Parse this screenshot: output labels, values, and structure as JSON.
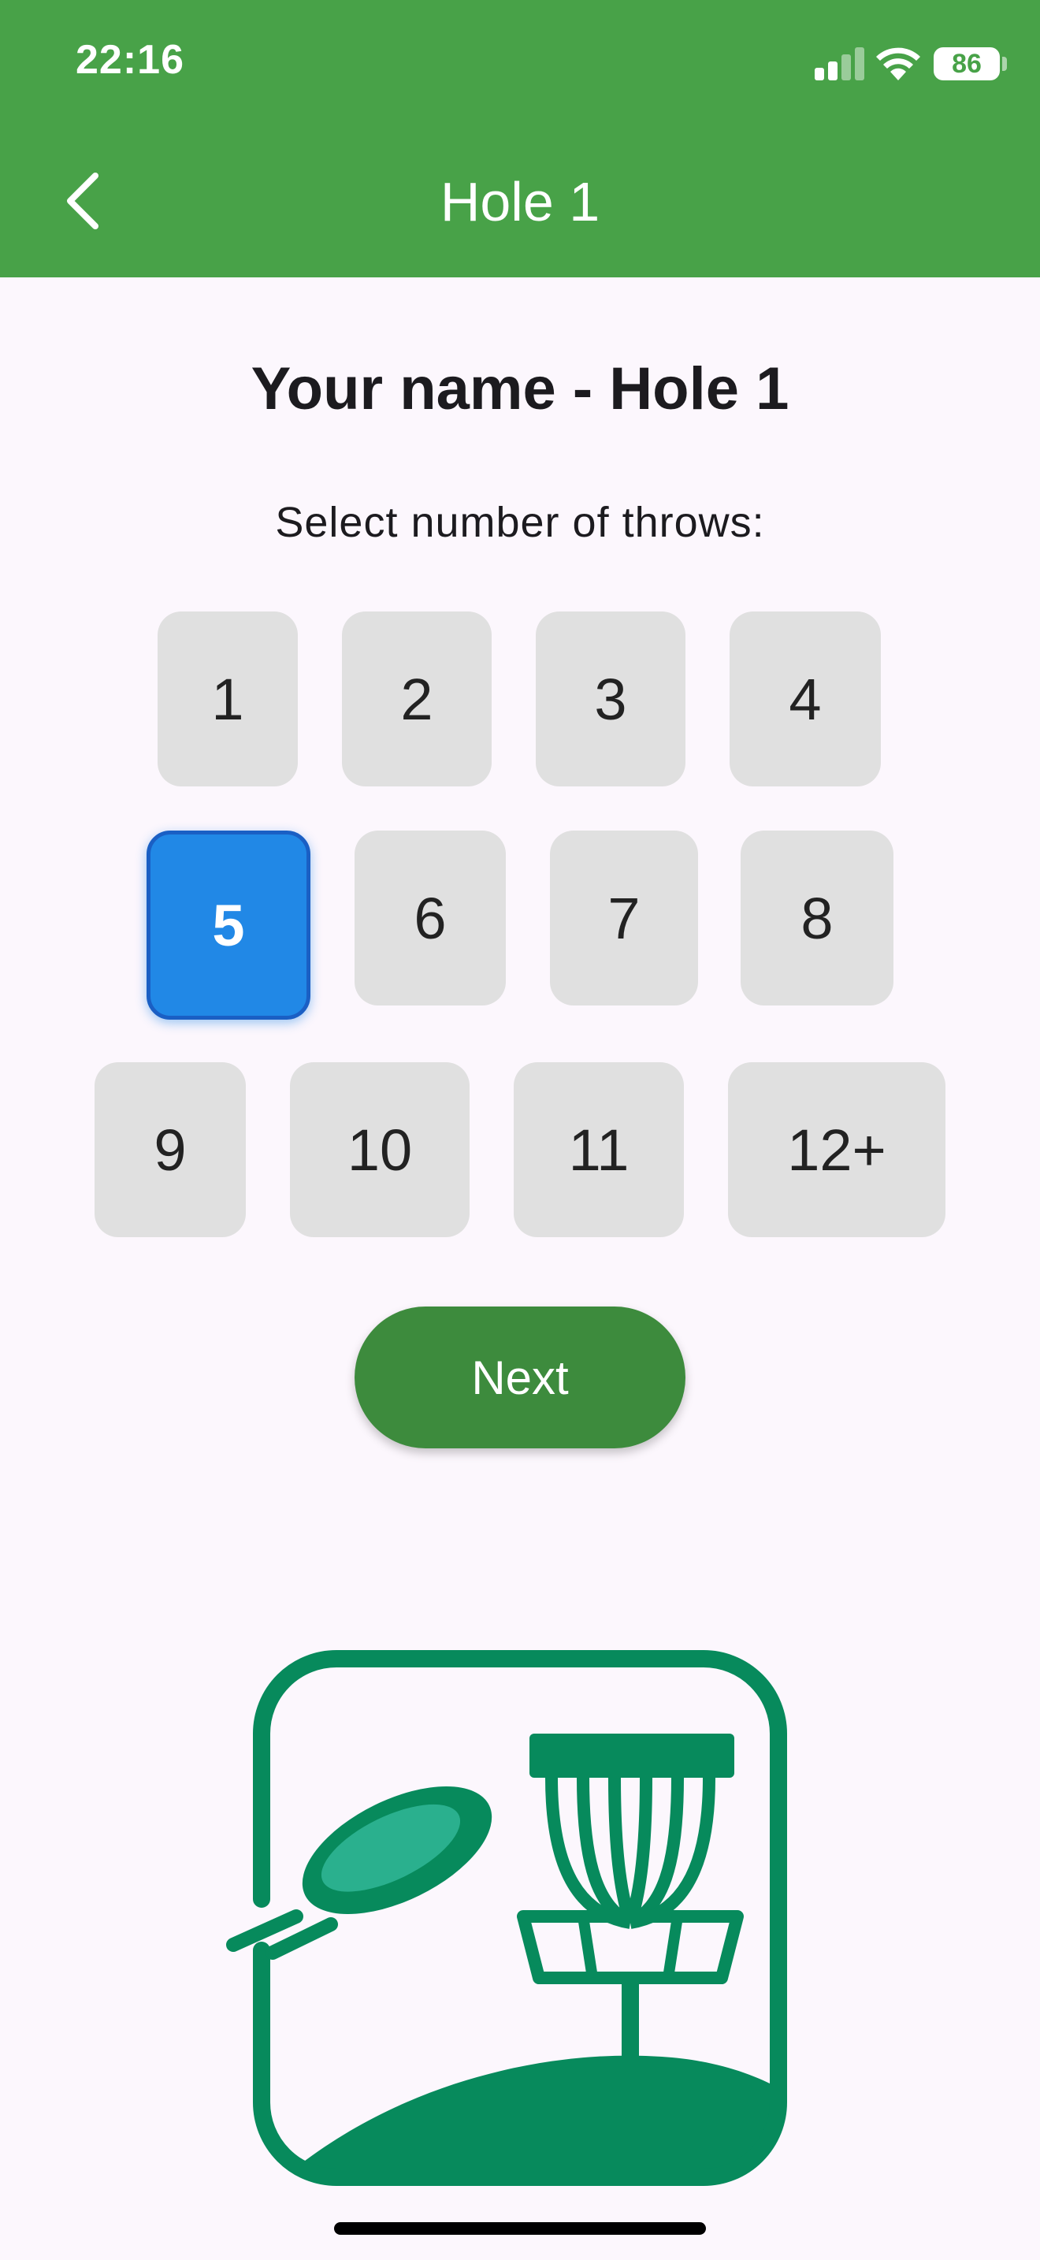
{
  "status_bar": {
    "time": "22:16",
    "battery": "86"
  },
  "app_bar": {
    "title": "Hole 1",
    "back_icon": "chevron-left-icon"
  },
  "screen": {
    "player_title": "Your name - Hole 1",
    "prompt": "Select number of throws:",
    "throw_options": [
      "1",
      "2",
      "3",
      "4",
      "5",
      "6",
      "7",
      "8",
      "9",
      "10",
      "11",
      "12+"
    ],
    "selected_throw": "5",
    "next_label": "Next"
  },
  "colors": {
    "app_bar": "#48a248",
    "selected": "#2188e6",
    "button_bg": "#e0e0e0",
    "next_button": "#3d8b3d",
    "logo": "#078a5c",
    "background": "#fcf7fd"
  },
  "logo_icon": "disc-golf-basket-icon"
}
